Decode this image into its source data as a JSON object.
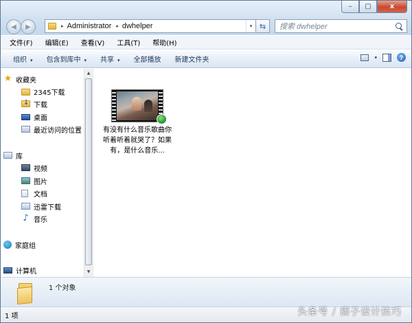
{
  "window": {
    "controls": {
      "minimize": "–",
      "maximize": "▢",
      "close": "x"
    }
  },
  "address_bar": {
    "crumbs": [
      "Administrator",
      "dwhelper"
    ],
    "separator": "▸",
    "dropdown": "▾",
    "refresh": "⇆"
  },
  "nav_buttons": {
    "back": "◀",
    "forward": "▶",
    "dropdown": "▾"
  },
  "search": {
    "placeholder": "搜索 dwhelper"
  },
  "menu": [
    "文件(F)",
    "编辑(E)",
    "查看(V)",
    "工具(T)",
    "帮助(H)"
  ],
  "commands": [
    {
      "label": "组织",
      "has_dropdown": true
    },
    {
      "label": "包含到库中",
      "has_dropdown": true
    },
    {
      "label": "共享",
      "has_dropdown": true
    },
    {
      "label": "全部播放",
      "has_dropdown": false
    },
    {
      "label": "新建文件夹",
      "has_dropdown": false
    }
  ],
  "command_caret": "▾",
  "help_label": "?",
  "navigation": {
    "favorites": {
      "label": "收藏夹",
      "items": [
        "2345下载",
        "下载",
        "桌面",
        "最近访问的位置"
      ]
    },
    "libraries": {
      "label": "库",
      "items": [
        "视频",
        "图片",
        "文档",
        "迅雷下载",
        "音乐"
      ]
    },
    "homegroup": {
      "label": "家庭组"
    },
    "computer": {
      "label": "计算机"
    }
  },
  "scrollbar": {
    "up": "▲",
    "down": "▼"
  },
  "files": [
    {
      "name": "有没有什么音乐歌曲你听着听着就哭了？如果有，是什么音乐...",
      "type": "video"
    }
  ],
  "details_pane": {
    "summary": "1 个对象"
  },
  "status_bar": {
    "text": "1 项"
  },
  "watermark": "头条号 / 痞子设计技巧"
}
